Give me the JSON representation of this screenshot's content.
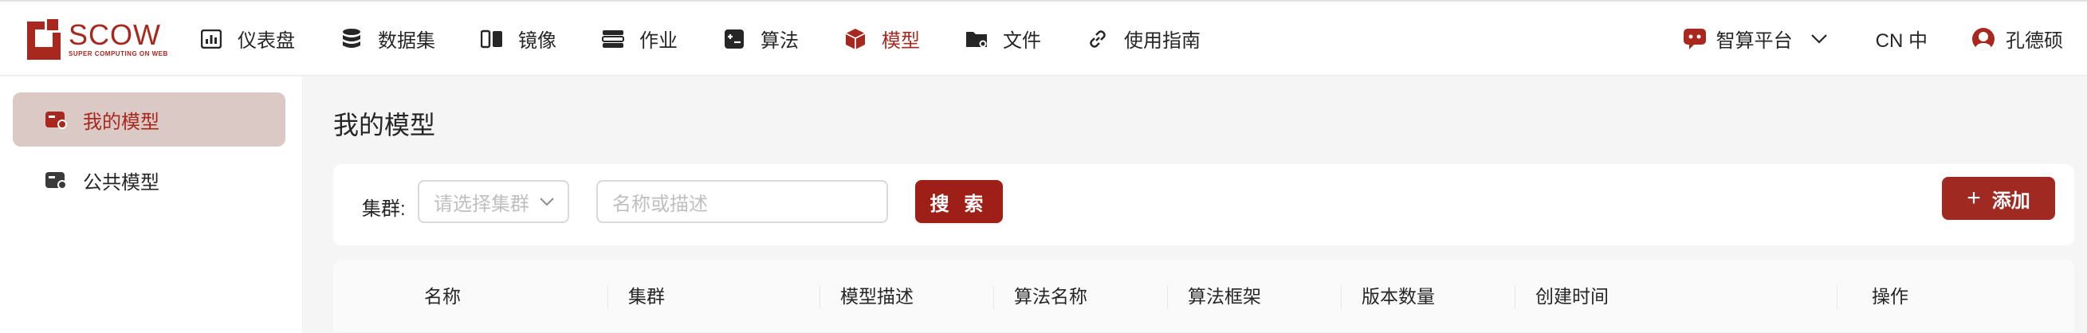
{
  "brand": {
    "name": "SCOW",
    "tagline": "SUPER COMPUTING ON WEB",
    "color": "#a8281f"
  },
  "nav": {
    "items": [
      {
        "label": "仪表盘",
        "icon": "dashboard-icon"
      },
      {
        "label": "数据集",
        "icon": "database-icon"
      },
      {
        "label": "镜像",
        "icon": "image-icon"
      },
      {
        "label": "作业",
        "icon": "job-icon"
      },
      {
        "label": "算法",
        "icon": "algorithm-icon"
      },
      {
        "label": "模型",
        "icon": "model-cube-icon",
        "active": true
      },
      {
        "label": "文件",
        "icon": "folder-icon"
      },
      {
        "label": "使用指南",
        "icon": "link-icon"
      }
    ]
  },
  "header_right": {
    "platform": "智算平台",
    "language": "CN 中",
    "user": "孔德硕"
  },
  "sidebar": {
    "items": [
      {
        "label": "我的模型",
        "active": true
      },
      {
        "label": "公共模型",
        "active": false
      }
    ]
  },
  "page": {
    "title": "我的模型"
  },
  "filter": {
    "cluster_label": "集群:",
    "cluster_placeholder": "请选择集群",
    "search_placeholder": "名称或描述",
    "search_button": "搜 索",
    "add_button": "添加"
  },
  "table": {
    "columns": [
      "名称",
      "集群",
      "模型描述",
      "算法名称",
      "算法框架",
      "版本数量",
      "创建时间",
      "操作"
    ]
  }
}
